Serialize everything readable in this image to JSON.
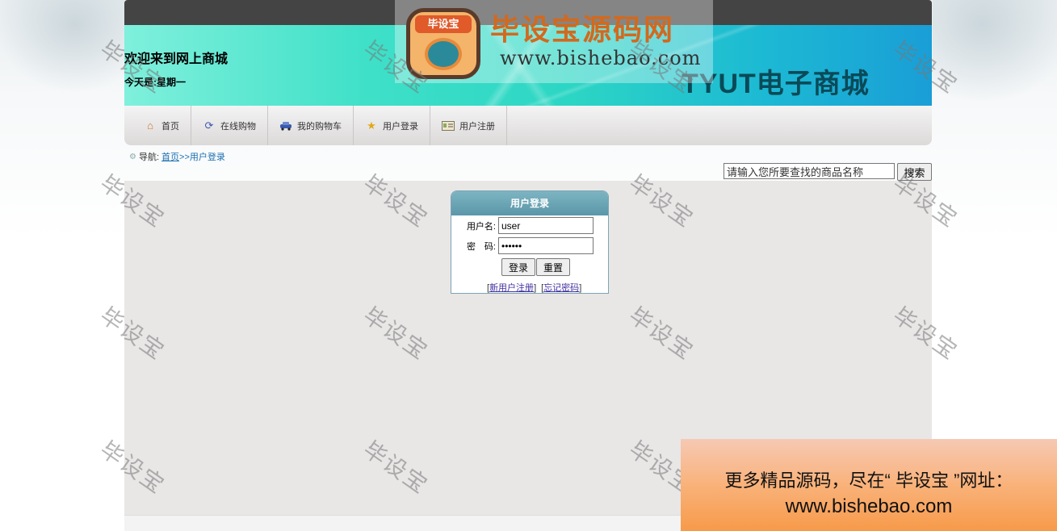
{
  "header": {
    "welcome": "欢迎来到网上商城",
    "today": "今天是:星期一",
    "shop_name": "TYUT电子商城"
  },
  "logo": {
    "badge": "毕设宝",
    "title": "毕设宝源码网",
    "url": "www.bishebao.com"
  },
  "nav": {
    "items": [
      {
        "label": "首页",
        "icon": "home-icon"
      },
      {
        "label": "在线购物",
        "icon": "refresh-icon"
      },
      {
        "label": "我的购物车",
        "icon": "car-icon"
      },
      {
        "label": "用户登录",
        "icon": "star-icon"
      },
      {
        "label": "用户注册",
        "icon": "id-card-icon"
      }
    ]
  },
  "breadcrumb": {
    "prefix": "导航:",
    "home": "首页",
    "current": ">>用户登录"
  },
  "search": {
    "value": "请输入您所要查找的商品名称",
    "button": "搜索"
  },
  "login": {
    "title": "用户登录",
    "username_label": "用户名:",
    "username_value": "user",
    "password_label": "密　码:",
    "password_value": "••••••",
    "submit": "登录",
    "reset": "重置",
    "register_link": "新用户注册",
    "forgot_link": "忘记密码"
  },
  "watermark": "毕设宝",
  "promo": {
    "line1": "更多精品源码，尽在“ 毕设宝 ”网址：",
    "line2": "www.bishebao.com"
  }
}
